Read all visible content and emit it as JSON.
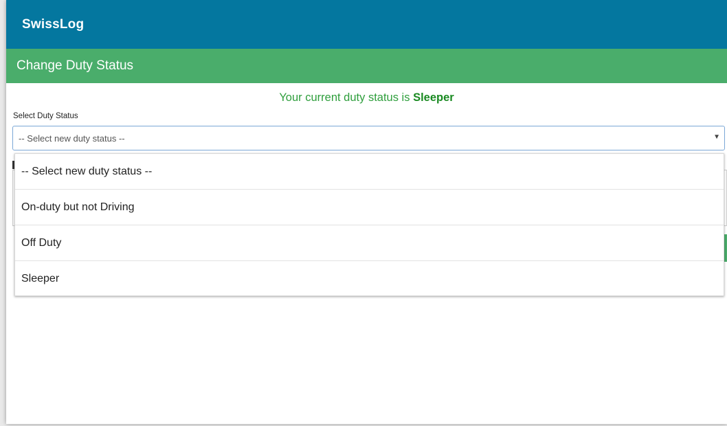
{
  "app": {
    "title": "SwissLog"
  },
  "page": {
    "title": "Change Duty Status"
  },
  "status": {
    "prefix": "Your current duty status is ",
    "value": "Sleeper"
  },
  "form": {
    "duty_status_label": "Select Duty Status",
    "duty_status_value": "-- Select new duty status --"
  },
  "dropdown": {
    "options": [
      {
        "label": "-- Select new duty status --"
      },
      {
        "label": "On-duty but not Driving"
      },
      {
        "label": "Off Duty"
      },
      {
        "label": "Sleeper"
      }
    ]
  },
  "colors": {
    "appbar": "#04779f",
    "subheader": "#4aad6b",
    "status_text": "#2e9e3c"
  }
}
